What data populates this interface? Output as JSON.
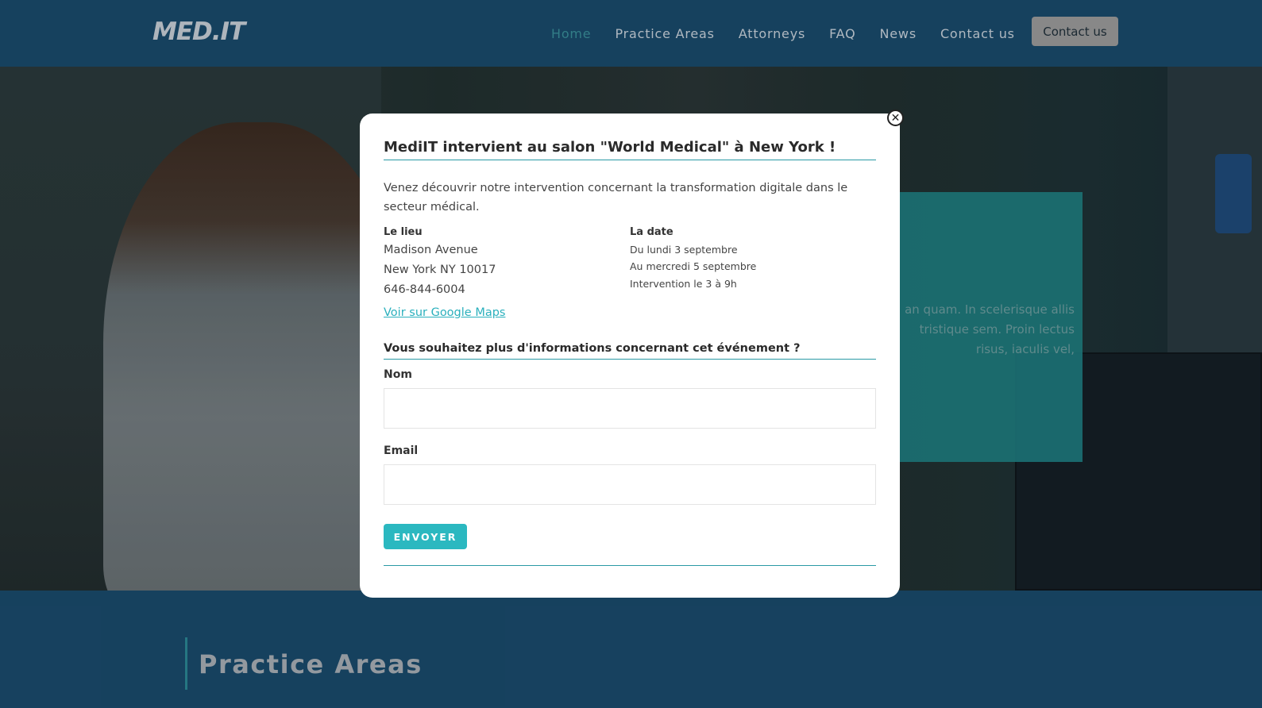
{
  "header": {
    "logo": "MED.IT",
    "nav": [
      "Home",
      "Practice Areas",
      "Attorneys",
      "FAQ",
      "News",
      "Contact us"
    ],
    "contact_button": "Contact us"
  },
  "hero": {
    "panel_text": "an quam. In scelerisque allis tristique sem. Proin lectus risus, iaculis vel,"
  },
  "section": {
    "title": "Practice Areas"
  },
  "modal": {
    "title": "MediIT intervient au salon \"World Medical\" à New York !",
    "intro": "Venez découvrir notre intervention concernant la transformation digitale dans le secteur médical.",
    "lieu_label": "Le lieu",
    "lieu_lines": [
      "Madison Avenue",
      "New York NY 10017",
      "646-844-6004"
    ],
    "maps_link": "Voir sur Google Maps",
    "date_label": "La date",
    "date_lines": [
      "Du lundi 3 septembre",
      "Au mercredi 5 septembre",
      "Intervention le 3 à 9h"
    ],
    "form_title": "Vous souhaitez plus d'informations concernant cet événement ?",
    "nom_label": "Nom",
    "nom_value": "",
    "email_label": "Email",
    "email_value": "",
    "submit_label": "ENVOYER",
    "close_icon": "close-icon"
  },
  "colors": {
    "header_bg": "#1a4a6c",
    "accent": "#2bb8c0",
    "nav_active": "#3a8f9a"
  }
}
